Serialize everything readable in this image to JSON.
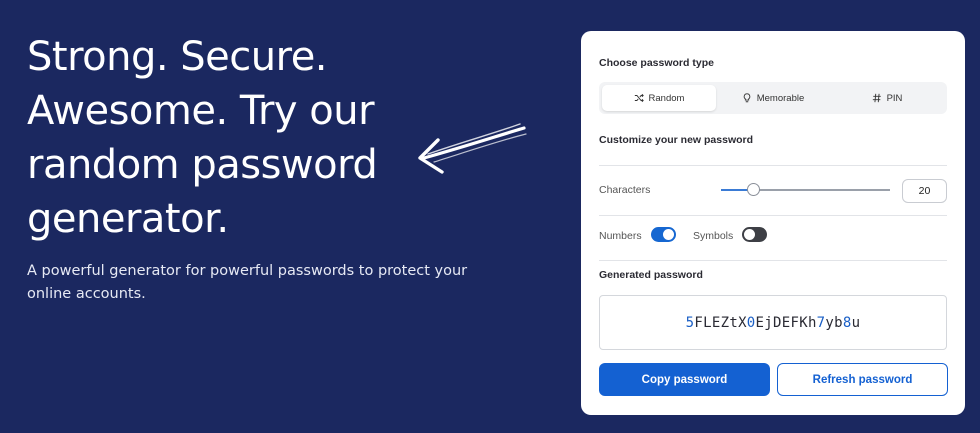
{
  "hero": {
    "title_lines": [
      "Strong. Secure.",
      "Awesome. Try our",
      "random password",
      "generator."
    ],
    "subtitle": "A powerful generator for powerful passwords to protect your online accounts."
  },
  "card": {
    "type_heading": "Choose password type",
    "types": [
      {
        "label": "Random",
        "icon": "shuffle-icon",
        "active": true
      },
      {
        "label": "Memorable",
        "icon": "lightbulb-icon",
        "active": false
      },
      {
        "label": "PIN",
        "icon": "hash-icon",
        "active": false
      }
    ],
    "customize_heading": "Customize your new password",
    "characters_label": "Characters",
    "characters_value": "20",
    "characters_min": 1,
    "characters_max": 100,
    "numbers_label": "Numbers",
    "numbers_on": true,
    "symbols_label": "Symbols",
    "symbols_on": false,
    "generated_heading": "Generated password",
    "password": "5FLEZtX0EjDEFKh7yb8u",
    "copy_label": "Copy password",
    "refresh_label": "Refresh password"
  },
  "colors": {
    "background": "#1b2860",
    "accent": "#1461d2",
    "digit": "#1a5fc6"
  }
}
